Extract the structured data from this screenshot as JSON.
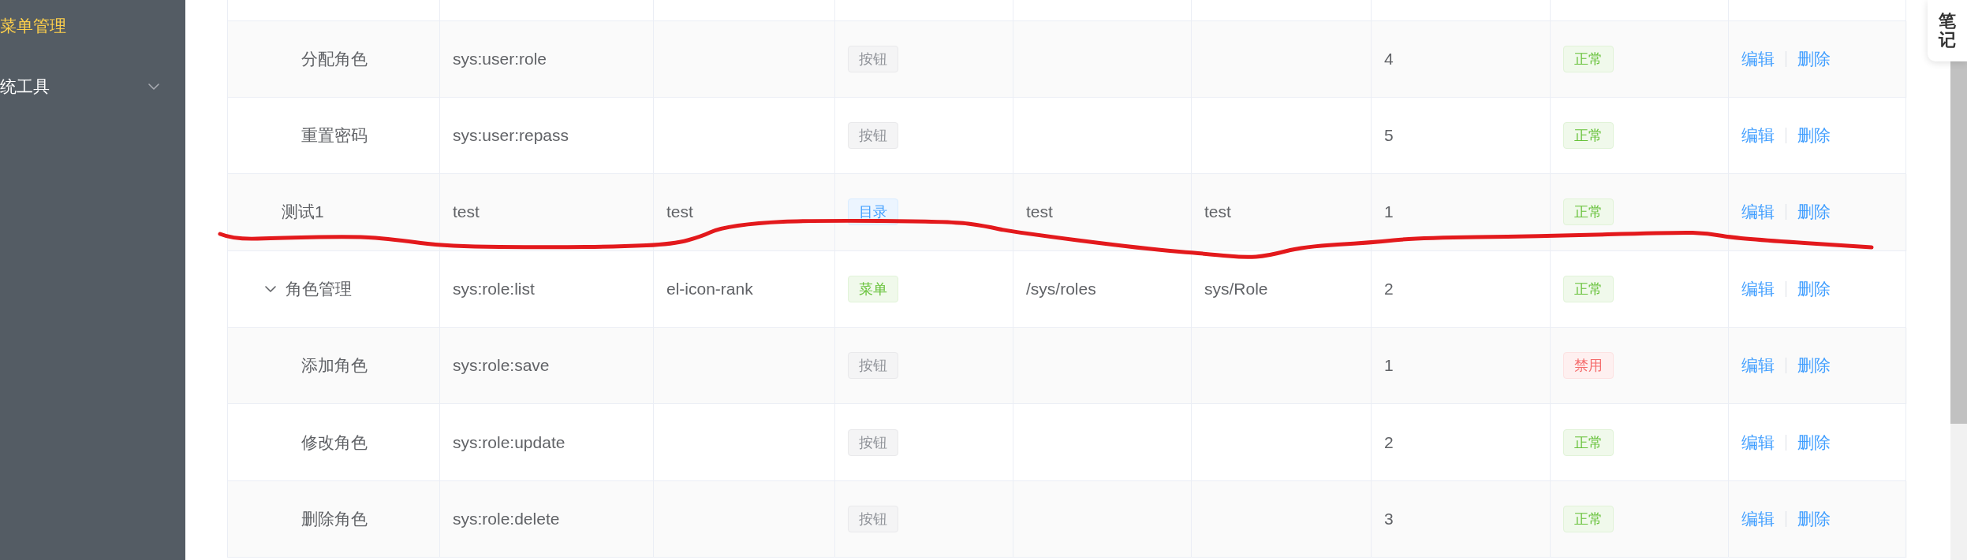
{
  "sidebar": {
    "items": [
      {
        "kind": "item",
        "label": "菜单管理",
        "selected": true
      },
      {
        "kind": "submenu",
        "label": "统工具",
        "selected": false,
        "expanded": false
      }
    ]
  },
  "table": {
    "rows": [
      {
        "children": [
          {
            "column_1": "分配角色",
            "column_2": "sys:user:role",
            "column_4": {
              "text": "按钮",
              "color": "#909399"
            },
            "column_7": "4",
            "column_8": {
              "text": "正常",
              "color": "#67c23a"
            },
            "column_9": [
              "编辑",
              "删除"
            ]
          },
          {
            "column_1": "重置密码",
            "column_2": "sys:user:repass",
            "column_4": {
              "text": "按钮",
              "color": "#909399"
            },
            "column_7": "5",
            "column_8": {
              "text": "正常",
              "color": "#67c23a"
            },
            "column_9": [
              "编辑",
              "删除"
            ]
          }
        ]
      },
      {
        "column_1": "测试1",
        "column_2": "test",
        "column_3": "test",
        "column_4": {
          "text": "目录",
          "color": "#409eff"
        },
        "column_5": "test",
        "column_6": "test",
        "column_7": "1",
        "column_8": {
          "text": "正常",
          "color": "#67c23a"
        },
        "column_9": [
          "编辑",
          "删除"
        ]
      },
      {
        "column_1": "角色管理",
        "expanded": true,
        "column_2": "sys:role:list",
        "column_3": "el-icon-rank",
        "column_4": {
          "text": "菜单",
          "color": "#67c23a"
        },
        "column_5": "/sys/roles",
        "column_6": "sys/Role",
        "column_7": "2",
        "column_8": {
          "text": "正常",
          "color": "#67c23a"
        },
        "column_9": [
          "编辑",
          "删除"
        ],
        "children": [
          {
            "column_1": "添加角色",
            "column_2": "sys:role:save",
            "column_4": {
              "text": "按钮",
              "color": "#909399"
            },
            "column_7": "1",
            "column_8": {
              "text": "禁用",
              "color": "#f56c6c"
            },
            "column_9": [
              "编辑",
              "删除"
            ]
          },
          {
            "column_1": "修改角色",
            "column_2": "sys:role:update",
            "column_4": {
              "text": "按钮",
              "color": "#909399"
            },
            "column_7": "2",
            "column_8": {
              "text": "正常",
              "color": "#67c23a"
            },
            "column_9": [
              "编辑",
              "删除"
            ]
          },
          {
            "column_1": "删除角色",
            "column_2": "sys:role:delete",
            "column_4": {
              "text": "按钮",
              "color": "#909399"
            },
            "column_7": "3",
            "column_8": {
              "text": "正常",
              "color": "#67c23a"
            },
            "column_9": [
              "编辑",
              "删除"
            ]
          }
        ]
      }
    ]
  },
  "note_tab": {
    "label": "笔记"
  },
  "annotation": {
    "kind": "freehand-line"
  }
}
